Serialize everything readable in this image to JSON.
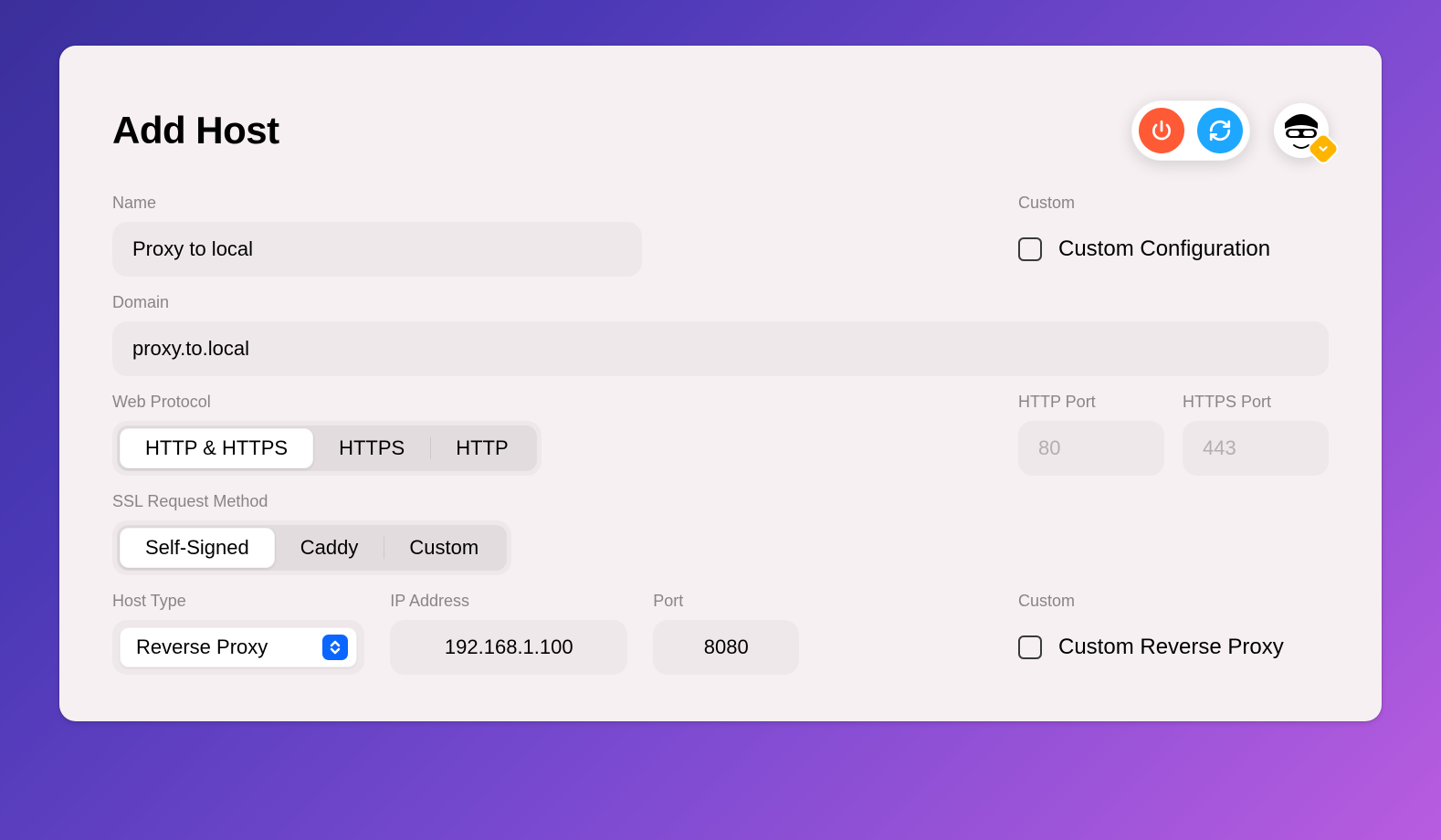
{
  "page_title": "Add Host",
  "header": {
    "power_icon": "power-icon",
    "refresh_icon": "refresh-icon",
    "avatar_badge_icon": "chevron-down-icon"
  },
  "form": {
    "name": {
      "label": "Name",
      "value": "Proxy to local"
    },
    "domain": {
      "label": "Domain",
      "value": "proxy.to.local"
    },
    "web_protocol": {
      "label": "Web Protocol",
      "options": [
        "HTTP & HTTPS",
        "HTTPS",
        "HTTP"
      ],
      "selected_index": 0
    },
    "ssl_method": {
      "label": "SSL Request Method",
      "options": [
        "Self-Signed",
        "Caddy",
        "Custom"
      ],
      "selected_index": 0
    },
    "host_type": {
      "label": "Host Type",
      "selected": "Reverse Proxy"
    },
    "ip_address": {
      "label": "IP Address",
      "value": "192.168.1.100"
    },
    "port": {
      "label": "Port",
      "value": "8080"
    },
    "http_port": {
      "label": "HTTP Port",
      "placeholder": "80"
    },
    "https_port": {
      "label": "HTTPS Port",
      "placeholder": "443"
    }
  },
  "custom": {
    "label": "Custom",
    "configuration_checkbox": {
      "label": "Custom Configuration",
      "checked": false
    },
    "reverse_proxy_checkbox": {
      "label": "Custom Reverse Proxy",
      "checked": false
    }
  }
}
